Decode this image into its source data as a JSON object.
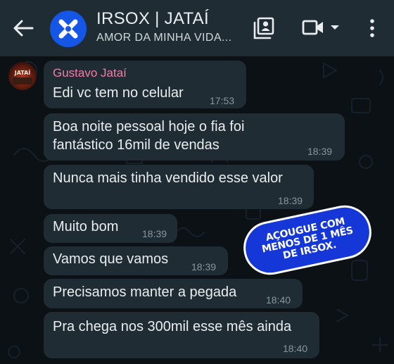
{
  "header": {
    "title": "IRSOX | JATAÍ",
    "subtitle": "AMOR DA MINHA VIDA...",
    "icons": {
      "back": "arrow-left-icon",
      "contacts": "contact-card-icon",
      "video": "video-camera-icon",
      "dropdown": "chevron-down-icon",
      "menu": "more-vertical-icon"
    }
  },
  "sender": {
    "name": "Gustavo Jataí",
    "avatar_text": "JATAÍ"
  },
  "messages": [
    {
      "text": "Edi vc tem no celular",
      "time": "17:53"
    },
    {
      "text_lines": [
        "Boa noite pessoal hoje o fia foi",
        "fantástico 16mil de vendas"
      ],
      "time": "18:39"
    },
    {
      "text": "Nunca mais tinha vendido esse valor",
      "time": "18:39"
    },
    {
      "text": "Muito bom",
      "time": "18:39"
    },
    {
      "text": "Vamos que vamos",
      "time": "18:39"
    },
    {
      "text": "Precisamos manter a pegada",
      "time": "18:40"
    },
    {
      "text": "Pra chega nos 300mil esse mês ainda",
      "time": "18:40"
    }
  ],
  "sticker": {
    "lines": [
      "AÇOUGUE COM",
      "MENOS DE 1 MÊS",
      "DE IRSOX."
    ]
  },
  "colors": {
    "header_bg": "#1f2c33",
    "chat_bg": "#0b1115",
    "bubble_bg": "#202c33",
    "sender_name": "#f27ea9",
    "timestamp": "#8696a0",
    "avatar_blue": "#1656e6",
    "sticker_blue": "#1637d8"
  }
}
